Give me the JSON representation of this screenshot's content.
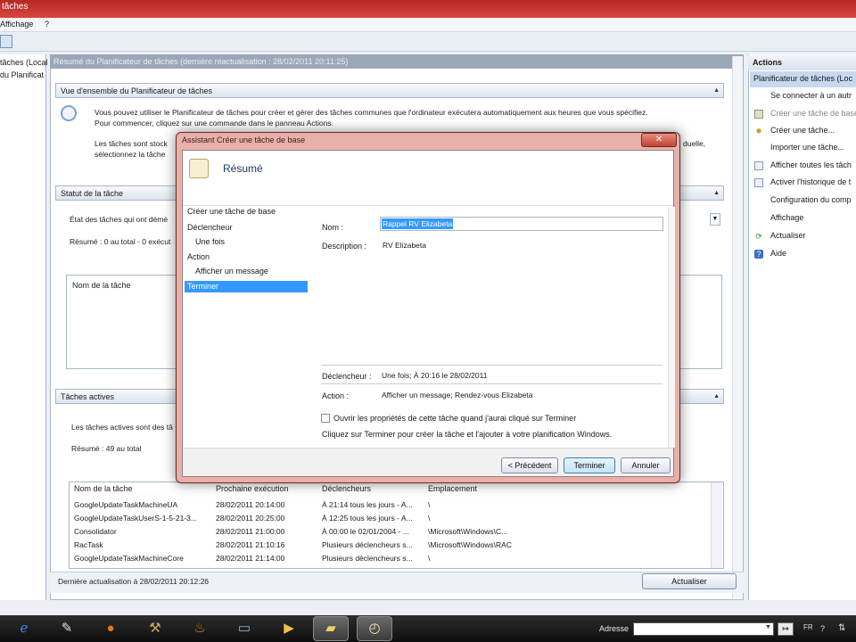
{
  "window": {
    "title": "tâches"
  },
  "menu": {
    "items": [
      "Affichage",
      "?"
    ]
  },
  "tree": {
    "items": [
      "tâches (Local",
      "du Planificat"
    ]
  },
  "center": {
    "header": "Résumé du Planificateur de tâches (dernière réactualisation : 28/02/2011 20:11:25)",
    "overview": {
      "title": "Vue d'ensemble du Planificateur de tâches",
      "line1": "Vous pouvez utiliser le Planificateur de tâches pour créer et gérer des tâches communes que l'ordinateur exécutera automatiquement aux heures que vous spécifiez.",
      "line2": "Pour commencer, cliquez sur une commande dans le panneau Actions.",
      "line3_left": "Les tâches sont stock",
      "line3_right": "duelle,",
      "line4": "sélectionnez la tâche"
    },
    "status": {
      "title": "Statut de la tâche",
      "filter_label": "État des tâches qui ont démé",
      "summary": "Résumé : 0 au total - 0 exécut",
      "col_name": "Nom de la tâche"
    },
    "active": {
      "title": "Tâches actives",
      "desc": "Les tâches actives sont des tâ",
      "summary": "Résumé : 49 au total",
      "columns": [
        "Nom de la tâche",
        "Prochaine exécution",
        "Déclencheurs",
        "Emplacement"
      ],
      "rows": [
        [
          "GoogleUpdateTaskMachineUA",
          "28/02/2011 20:14:00",
          "À 21:14 tous les jours - A...",
          "\\"
        ],
        [
          "GoogleUpdateTaskUserS-1-5-21-3...",
          "28/02/2011 20:25:00",
          "À 12:25 tous les jours - A...",
          "\\"
        ],
        [
          "Consolidator",
          "28/02/2011 21:00:00",
          "À 00:00 le 02/01/2004 - ...",
          "\\Microsoft\\Windows\\C..."
        ],
        [
          "RacTask",
          "28/02/2011 21:10:16",
          "Plusieurs déclencheurs s...",
          "\\Microsoft\\Windows\\RAC"
        ],
        [
          "GoogleUpdateTaskMachineCore",
          "28/02/2011 21:14:00",
          "Plusieurs déclencheurs s...",
          "\\"
        ]
      ]
    },
    "footer": {
      "last_update": "Dernière actualisation à 28/02/2011 20:12:26",
      "refresh_button": "Actualiser"
    }
  },
  "actions": {
    "title": "Actions",
    "subtitle": "Planificateur de tâches (Loc",
    "items": [
      {
        "label": "Se connecter à un autr",
        "icon": "none"
      },
      {
        "label": "Créer une tâche de base",
        "icon": "create-basic-task-icon"
      },
      {
        "label": "Créer une tâche...",
        "icon": "create-task-icon"
      },
      {
        "label": "Importer une tâche...",
        "icon": "none"
      },
      {
        "label": "Afficher toutes les tâch",
        "icon": "list-icon"
      },
      {
        "label": "Activer l'historique de t",
        "icon": "history-icon"
      },
      {
        "label": "Configuration du comp",
        "icon": "none"
      },
      {
        "label": "Affichage",
        "icon": "none"
      },
      {
        "label": "Actualiser",
        "icon": "refresh-icon"
      },
      {
        "label": "Aide",
        "icon": "help-icon"
      }
    ]
  },
  "dialog": {
    "title": "Assistant Créer une tâche de base",
    "heading": "Résumé",
    "nav": [
      "Créer une tâche de base",
      "Déclencheur",
      "Une fois",
      "Action",
      "Afficher un message",
      "Terminer"
    ],
    "name_label": "Nom :",
    "name_value": "Rappel RV Elizabeta",
    "desc_label": "Description :",
    "desc_value": "RV Elizabeta",
    "trigger_label": "Déclencheur :",
    "trigger_value": "Une fois; À 20:16 le 28/02/2011",
    "action_label": "Action :",
    "action_value": "Afficher un message; Rendez-vous Elizabeta",
    "checkbox_label": "Ouvrir les propriétés de cette tâche quand j'aurai cliqué sur Terminer",
    "hint": "Cliquez sur Terminer pour créer la tâche et l'ajouter à votre planification Windows.",
    "btn_back": "< Précédent",
    "btn_finish": "Terminer",
    "btn_cancel": "Annuler"
  },
  "taskbar": {
    "address_label": "Adresse",
    "lang": "FR",
    "icons": [
      "ie-icon",
      "paint-icon",
      "firefox-icon",
      "tools-icon",
      "flame-icon",
      "monitor-icon",
      "media-icon",
      "folder-icon",
      "task-scheduler-icon"
    ]
  },
  "colors": {
    "accent": "#c9302c",
    "selection": "#3399ff"
  }
}
